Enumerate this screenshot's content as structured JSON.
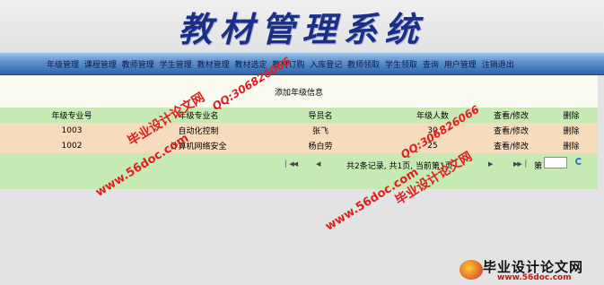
{
  "app": {
    "title": "教材管理系统"
  },
  "nav": {
    "items": [
      "年级管理",
      "课程管理",
      "教师管理",
      "学生管理",
      "教材管理",
      "教材选定",
      "教材订购",
      "入库登记",
      "教师领取",
      "学生领取",
      "查询",
      "用户管理",
      "注销退出"
    ]
  },
  "form": {
    "title": "添加年级信息"
  },
  "table": {
    "columns": [
      "年级专业号",
      "年级专业名",
      "导员名",
      "年级人数",
      "查看/修改",
      "删除"
    ],
    "rows": [
      [
        "1003",
        "自动化控制",
        "张飞",
        "30",
        "查看/修改",
        "删除"
      ],
      [
        "1002",
        "计算机网络安全",
        "杨白劳",
        "25",
        "查看/修改",
        "删除"
      ]
    ]
  },
  "pager": {
    "summary": "共2条记录, 共1页, 当前第1页",
    "jump_label": "第",
    "jump_value": ""
  },
  "watermarks": {
    "url": "www.56doc.com",
    "qq": "QQ:306826066",
    "site": "毕业设计论文网"
  },
  "logo": {
    "text": "毕业设计论文网",
    "url": "www.56doc.com"
  },
  "colors": {
    "title": "#1c2f86",
    "nav_bar": "#2f64ad",
    "header_row": "#c7e9b4",
    "data_row": "#f6dcbc",
    "watermark": "#e02020"
  }
}
